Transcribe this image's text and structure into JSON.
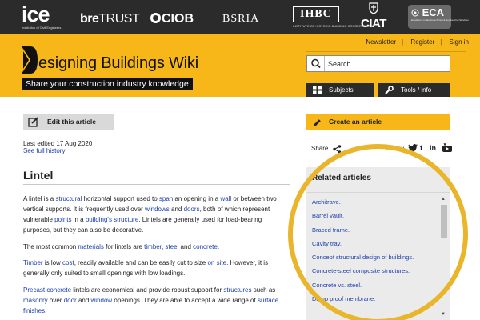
{
  "partners": {
    "ice": {
      "name": "ice",
      "sub": "Institution of Civil Engineers"
    },
    "bre_bold": "bre",
    "bre_light": "TRUST",
    "ciob": "CIOB",
    "bsria": "BSRIA",
    "ihbc": {
      "name": "IHBC",
      "sub": "INSTITUTE OF HISTORIC BUILDING CONSERVATION"
    },
    "ciat": "CIAT",
    "eca": {
      "name": "ECA",
      "sub": "Excellence in Electrotechnical & Engineering Services"
    }
  },
  "top_links": {
    "newsletter": "Newsletter",
    "register": "Register",
    "signin": "Sign in"
  },
  "site": {
    "title": "esigning Buildings Wiki",
    "tagline": "Share your construction industry knowledge"
  },
  "search": {
    "placeholder": "Search"
  },
  "nav": {
    "subjects": "Subjects",
    "tools": "Tools / info"
  },
  "article": {
    "edit_label": "Edit this article",
    "last_edited": "Last edited 17 Aug 2020",
    "history_link": "See full history",
    "title": "Lintel",
    "p1": {
      "t1": "A lintel is a ",
      "l1": "structural",
      "t2": " horizontal support used to ",
      "l2": "span",
      "t3": " an opening in a ",
      "l3": "wall",
      "t4": " or between two vertical supports. It is frequently used over ",
      "l4": "windows",
      "t5": " and ",
      "l5": "doors",
      "t6": ", both of which represent vulnerable ",
      "l6": "points",
      "t7": " in a ",
      "l7": "building's structure",
      "t8": ". Lintels are generally used for load-bearing purposes, but they can also be decorative."
    },
    "p2": {
      "t1": "The most common ",
      "l1": "materials",
      "t2": " for lintels are ",
      "l2": "timber",
      "t3": ", ",
      "l3": "steel",
      "t4": " and ",
      "l4": "concrete",
      "t5": "."
    },
    "p3": {
      "l1": "Timber",
      "t1": " is low ",
      "l2": "cost",
      "t2": ", readily available and can be easily cut to size ",
      "l3": "on site",
      "t3": ". However, it is generally only suited to small openings with low loadings."
    },
    "p4": {
      "l1": "Precast concrete",
      "t1": " lintels are economical and provide robust support for ",
      "l2": "structures",
      "t2": " such as ",
      "l3": "masonry",
      "t3": " over ",
      "l4": "door",
      "t4": " and ",
      "l5": "window",
      "t5": " openings. They are able to accept a wide range of ",
      "l6": "surface finishes",
      "t6": "."
    }
  },
  "sidebar": {
    "create_label": "Create an article",
    "share_label": "Share",
    "follow_label": "Follow",
    "related_title": "Related articles",
    "related": [
      "Architrave.",
      "Barrel vault.",
      "Braced frame.",
      "Cavity tray.",
      "Concept structural design of buildings.",
      "Concrete-steel composite structures.",
      "Concrete vs. steel.",
      "Damp proof membrane."
    ]
  },
  "colors": {
    "brand_yellow": "#f7b718",
    "dark": "#2b2b2b",
    "link": "#1a3fae",
    "highlight": "#e8b52b"
  }
}
